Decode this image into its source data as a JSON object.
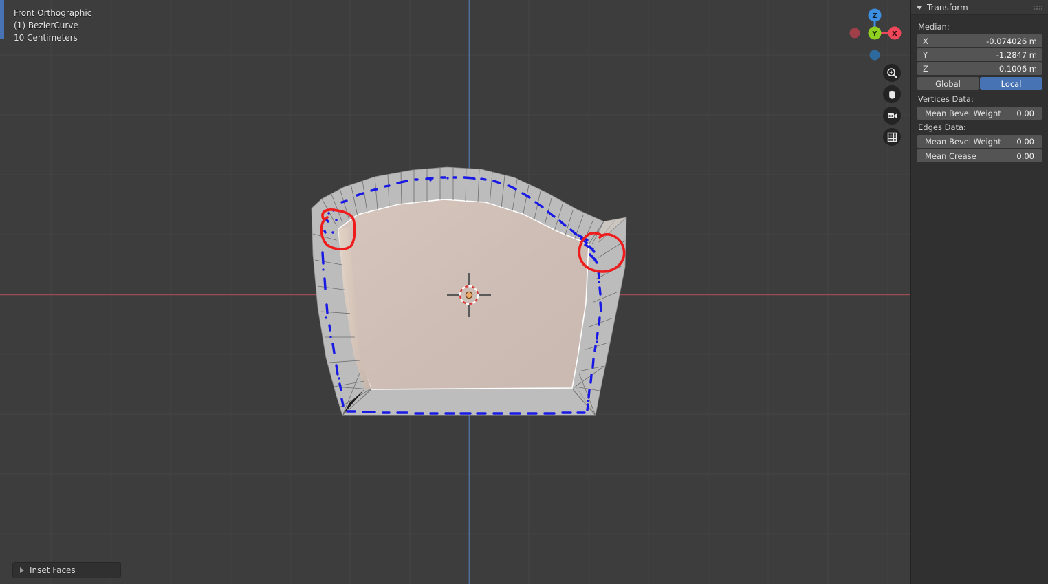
{
  "viewport": {
    "header_lines": [
      "Front Orthographic",
      "(1) BezierCurve",
      "10 Centimeters"
    ],
    "view_name": "Front Orthographic",
    "object_name": "(1) BezierCurve",
    "grid_scale": "10 Centimeters",
    "background_color": "#3d3d3d",
    "grid_line_color": "#4a4a4a",
    "x_axis_color": "#9b4b52",
    "z_axis_color": "#4f6f9e"
  },
  "gizmo": {
    "axes": [
      {
        "label": "Z",
        "color": "#3c8ee0",
        "position": "top"
      },
      {
        "label": "Y",
        "color": "#8fd020",
        "position": "center"
      },
      {
        "label": "X",
        "color": "#f0475b",
        "position": "right"
      },
      {
        "label": "",
        "color": "#9e3f49",
        "position": "left"
      },
      {
        "label": "",
        "color": "#2e6a9e",
        "position": "bottom"
      }
    ]
  },
  "viewport_tools": [
    {
      "name": "zoom-icon",
      "label": "Zoom"
    },
    {
      "name": "hand-icon",
      "label": "Move View"
    },
    {
      "name": "camera-icon",
      "label": "Camera View"
    },
    {
      "name": "grid-icon",
      "label": "Toggle Orthographic"
    }
  ],
  "operator_panel": {
    "label": "Inset Faces",
    "expanded": false
  },
  "mesh": {
    "selection_color": "#1919e6",
    "face_color": "#cdbdb4",
    "band_color": "#b9b9b9",
    "annotation_color": "#ee1c1c",
    "annotations": [
      {
        "name": "annotation-circle-left"
      },
      {
        "name": "annotation-circle-right"
      }
    ]
  },
  "sidebar": {
    "panel": {
      "title": "Transform",
      "expanded": true
    },
    "median_label": "Median:",
    "median": [
      {
        "axis": "X",
        "value": "-0.074026 m"
      },
      {
        "axis": "Y",
        "value": "-1.2847 m"
      },
      {
        "axis": "Z",
        "value": "0.1006 m"
      }
    ],
    "space_toggle": {
      "options": [
        "Global",
        "Local"
      ],
      "selected": "Local",
      "active_color": "#4772b3"
    },
    "vertices_data_label": "Vertices Data:",
    "vertices_data": [
      {
        "label": "Mean Bevel Weight",
        "value": "0.00"
      }
    ],
    "edges_data_label": "Edges Data:",
    "edges_data": [
      {
        "label": "Mean Bevel Weight",
        "value": "0.00"
      },
      {
        "label": "Mean Crease",
        "value": "0.00"
      }
    ]
  }
}
